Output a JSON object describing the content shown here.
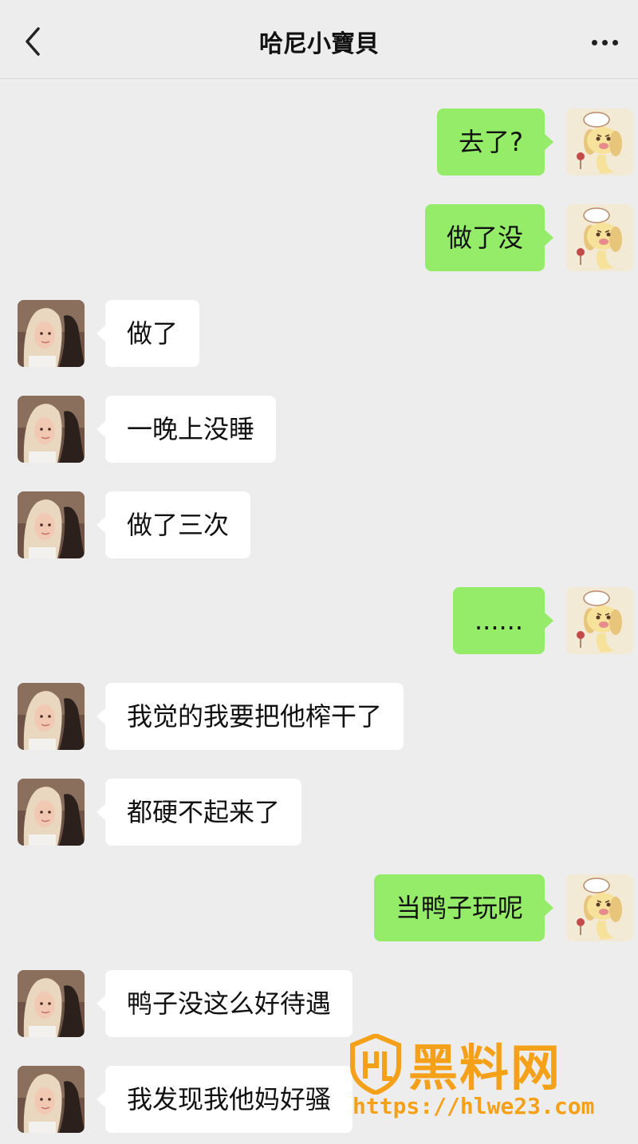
{
  "header": {
    "title": "哈尼小寶貝",
    "back_icon": "chevron-left-icon",
    "more_icon": "more-dots-icon"
  },
  "messages": [
    {
      "side": "right",
      "text": "去了?"
    },
    {
      "side": "right",
      "text": "做了没"
    },
    {
      "side": "left",
      "text": "做了"
    },
    {
      "side": "left",
      "text": "一晚上没睡"
    },
    {
      "side": "left",
      "text": "做了三次"
    },
    {
      "side": "right",
      "text": "......"
    },
    {
      "side": "left",
      "text": "我觉的我要把他榨干了"
    },
    {
      "side": "left",
      "text": "都硬不起来了"
    },
    {
      "side": "right",
      "text": "当鸭子玩呢"
    },
    {
      "side": "left",
      "text": "鸭子没这么好待遇"
    },
    {
      "side": "left",
      "text": "我发现我他妈好骚"
    }
  ],
  "watermark": {
    "brand": "黑料网",
    "url": "https://hlwe23.com"
  },
  "colors": {
    "background": "#ededed",
    "sent_bubble": "#95ec69",
    "received_bubble": "#ffffff",
    "watermark": "#f4a119"
  }
}
